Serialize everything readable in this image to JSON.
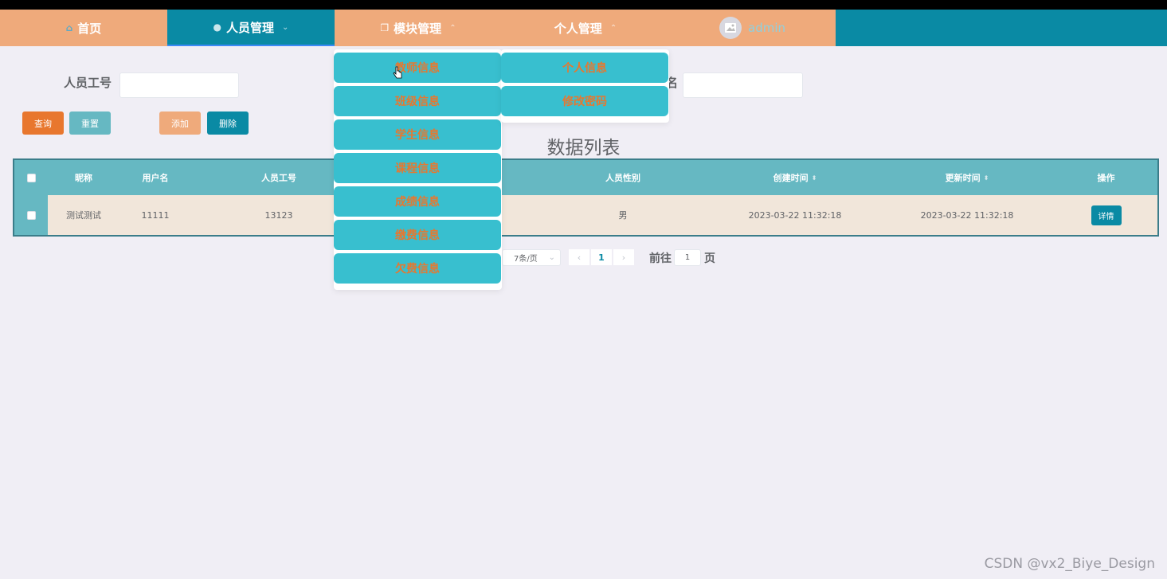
{
  "nav": {
    "home": "首页",
    "personnel": "人员管理",
    "modules": "模块管理",
    "personal": "个人管理",
    "user": "admin"
  },
  "search": {
    "staff_id_label": "人员工号",
    "name_label_partial": "名",
    "query": "查询",
    "reset": "重置",
    "add": "添加",
    "delete": "删除"
  },
  "list_title": "数据列表",
  "table": {
    "headers": [
      "昵称",
      "用户名",
      "人员工号",
      "人员性别",
      "创建时间",
      "更新时间",
      "操作"
    ],
    "rows": [
      {
        "nickname": "测试测试",
        "username": "11111",
        "staff_id": "13123",
        "gender": "男",
        "created": "2023-03-22 11:32:18",
        "updated": "2023-03-22 11:32:18",
        "action": "详情"
      }
    ]
  },
  "pagination": {
    "page_size": "7条/页",
    "prev": "‹",
    "page": "1",
    "next": "›",
    "goto_label": "前往",
    "goto_value": "1",
    "page_suffix": "页"
  },
  "modules_menu": [
    "教师信息",
    "班级信息",
    "学生信息",
    "课程信息",
    "成绩信息",
    "缴费信息",
    "欠费信息"
  ],
  "personal_menu": [
    "个人信息",
    "修改密码"
  ],
  "watermark": "CSDN @vx2_Biye_Design",
  "colors": {
    "nav_teal": "#0a8aa4",
    "nav_peach": "#efaa7b",
    "menu_item": "#38bfcf",
    "menu_text": "#e8772e",
    "query_btn": "#e8772e",
    "reset_btn": "#66b8c2"
  }
}
